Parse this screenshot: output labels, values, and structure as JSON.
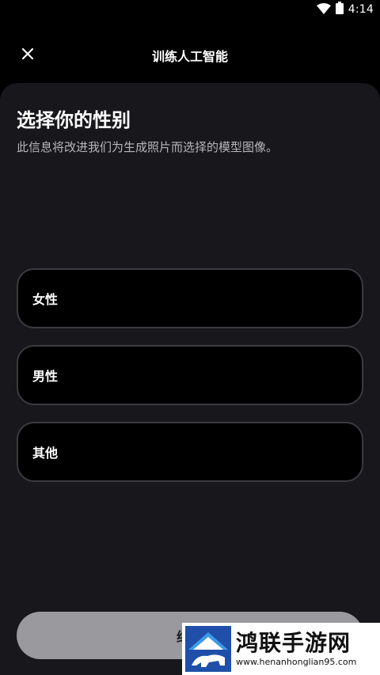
{
  "status_bar": {
    "time": "4:14"
  },
  "header": {
    "title": "训练人工智能"
  },
  "sheet": {
    "title": "选择你的性别",
    "subtitle": "此信息将改进我们为生成照片而选择的模型图像。",
    "options": [
      {
        "label": "女性"
      },
      {
        "label": "男性"
      },
      {
        "label": "其他"
      }
    ],
    "continue_label": "继续"
  },
  "watermark": {
    "name": "鸿联手游网",
    "url": "www.henanhonglian95.com"
  },
  "colors": {
    "background": "#000000",
    "sheet": "#18181c",
    "option_border": "#3a3a40",
    "button_disabled": "#9a9a9e",
    "subtitle": "#b5b5bb"
  }
}
